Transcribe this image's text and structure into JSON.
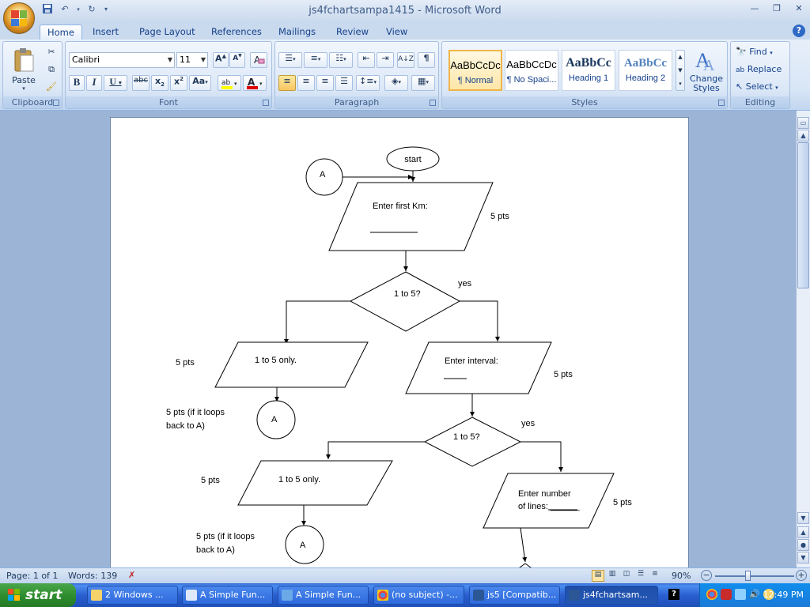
{
  "window": {
    "title": "js4fchartsampa1415 - Microsoft Word"
  },
  "tabs": [
    "Home",
    "Insert",
    "Page Layout",
    "References",
    "Mailings",
    "Review",
    "View"
  ],
  "clipboard": {
    "paste": "Paste",
    "label": "Clipboard"
  },
  "font": {
    "name": "Calibri",
    "size": "11",
    "label": "Font"
  },
  "paragraph": {
    "label": "Paragraph"
  },
  "styles": {
    "label": "Styles",
    "items": [
      {
        "sample": "AaBbCcDc",
        "name": "¶ Normal"
      },
      {
        "sample": "AaBbCcDc",
        "name": "¶ No Spaci..."
      },
      {
        "sample": "AaBbCc",
        "name": "Heading 1"
      },
      {
        "sample": "AaBbCc",
        "name": "Heading 2"
      }
    ],
    "change_styles": "Change Styles"
  },
  "editing": {
    "find": "Find",
    "replace": "Replace",
    "select": "Select",
    "label": "Editing"
  },
  "flowchart": {
    "start": "start",
    "connector": "A",
    "enter_km": "Enter first Km:",
    "decision1": "1 to 5?",
    "yes": "yes",
    "only": "1 to 5 only.",
    "enter_interval": "Enter interval:",
    "enter_lines": "Enter number of lines: ______",
    "enter_lines_1": "Enter number",
    "enter_lines_2": "of lines: ______",
    "pts": "5 pts",
    "loop_pts_1": "5 pts (if it loops",
    "loop_pts_2": "back to A)"
  },
  "status": {
    "page": "Page: 1 of 1",
    "words": "Words: 139",
    "zoom": "90%"
  },
  "taskbar": {
    "start": "start",
    "items": [
      "2 Windows ...",
      "A Simple Fun...",
      "A Simple Fun...",
      "(no subject) -...",
      "js5 [Compatib...",
      "js4fchartsam..."
    ],
    "clock": "12:49 PM"
  }
}
